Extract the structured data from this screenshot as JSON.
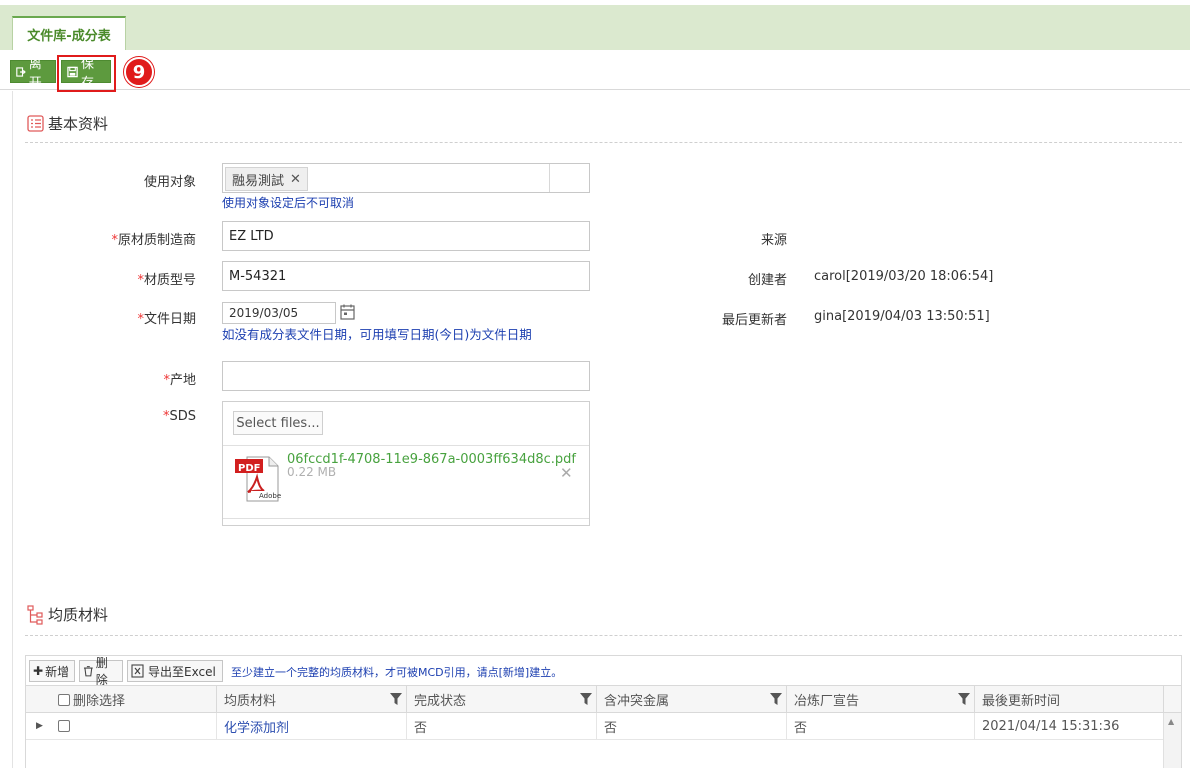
{
  "tabs": [
    {
      "label": "文件库-成分表"
    }
  ],
  "toolbar": {
    "leave_label": "离开",
    "save_label": "保存",
    "step_badge": "9"
  },
  "basic_section": {
    "title": "基本资料"
  },
  "form": {
    "target_label": "使用对象",
    "target_tag": "融易測試",
    "target_hint": "使用对象设定后不可取消",
    "manufacturer_label": "原材质制造商",
    "manufacturer_value": "EZ LTD",
    "model_label": "材质型号",
    "model_value": "M-54321",
    "doc_date_label": "文件日期",
    "doc_date_value": "2019/03/05",
    "doc_date_hint": "如没有成分表文件日期，可用填写日期(今日)为文件日期",
    "origin_label": "产地",
    "origin_value": "",
    "sds_label": "SDS",
    "select_files_label": "Select files...",
    "file_name": "06fccd1f-4708-11e9-867a-0003ff634d8c.pdf",
    "file_size": "0.22 MB",
    "pdf_badge": "PDF",
    "pdf_brand": "Adobe"
  },
  "info": {
    "source_label": "来源",
    "source_value": "",
    "creator_label": "创建者",
    "creator_value": "carol[2019/03/20 18:06:54]",
    "updater_label": "最后更新者",
    "updater_value": "gina[2019/04/03 13:50:51]"
  },
  "homogeneous_section": {
    "title": "均质材料"
  },
  "grid": {
    "add_label": "新增",
    "delete_label": "删除",
    "export_label": "导出至Excel",
    "note": "至少建立一个完整的均质材料，才可被MCD引用，请点[新增]建立。",
    "columns": [
      "删除选择",
      "均质材料",
      "完成状态",
      "含冲突金属",
      "冶炼厂宣告",
      "最後更新时间"
    ],
    "rows": [
      {
        "material": "化学添加剂",
        "complete": "否",
        "conflict_metal": "否",
        "smelter": "否",
        "updated": "2021/04/14 15:31:36"
      }
    ]
  }
}
